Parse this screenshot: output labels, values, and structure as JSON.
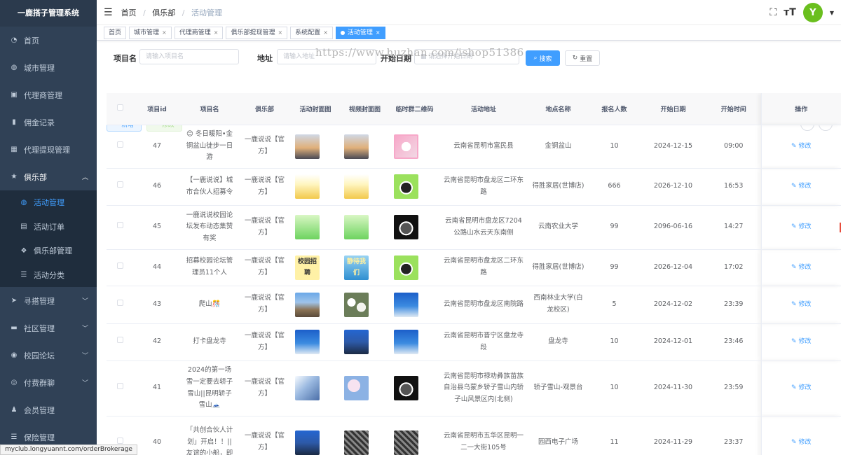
{
  "sidebar": {
    "title": "一鹿搭子管理系统",
    "items": [
      {
        "label": "首页",
        "icon": "dashboard-icon"
      },
      {
        "label": "城市管理",
        "icon": "globe-icon"
      },
      {
        "label": "代理商管理",
        "icon": "id-card-icon"
      },
      {
        "label": "佣金记录",
        "icon": "bar-chart-icon"
      },
      {
        "label": "代理提现管理",
        "icon": "table-icon"
      },
      {
        "label": "俱乐部",
        "icon": "star-icon"
      }
    ],
    "club_sub": [
      {
        "label": "活动管理",
        "icon": "globe-icon"
      },
      {
        "label": "活动订单",
        "icon": "document-icon"
      },
      {
        "label": "俱乐部管理",
        "icon": "user-group-icon"
      },
      {
        "label": "活动分类",
        "icon": "list-icon"
      }
    ],
    "items_after": [
      {
        "label": "寻搭管理",
        "icon": "send-icon"
      },
      {
        "label": "社区管理",
        "icon": "chat-icon"
      },
      {
        "label": "校园论坛",
        "icon": "forum-icon"
      },
      {
        "label": "付费群聊",
        "icon": "wechat-icon"
      },
      {
        "label": "会员管理",
        "icon": "member-icon"
      },
      {
        "label": "保险管理",
        "icon": "list-icon"
      }
    ]
  },
  "breadcrumb": {
    "home": "首页",
    "parent": "俱乐部",
    "current": "活动管理"
  },
  "tabs": [
    {
      "label": "首页"
    },
    {
      "label": "城市管理"
    },
    {
      "label": "代理商管理"
    },
    {
      "label": "俱乐部提现管理"
    },
    {
      "label": "系统配置"
    },
    {
      "label": "活动管理"
    }
  ],
  "avatar_text": "Y",
  "search": {
    "name_label": "项目名",
    "name_placeholder": "请输入项目名",
    "address_label": "地址",
    "address_placeholder": "请输入地址",
    "start_label": "开始日期",
    "start_placeholder": "请选择开始日期",
    "search_btn": "搜索",
    "reset_btn": "重置",
    "add_btn": "新增",
    "edit_btn": "修改"
  },
  "watermark": "https://www.huzhan.com/ishop51386",
  "table": {
    "headers": [
      "项目id",
      "项目名",
      "俱乐部",
      "活动封面图",
      "视频封面图",
      "临时群二维码",
      "活动地址",
      "地点名称",
      "报名人数",
      "开始日期",
      "开始时间",
      "操作"
    ],
    "edit_label": "修改",
    "rows": [
      {
        "id": "47",
        "name": "😊 冬日暖阳•金铜盆山徒步一日游",
        "club": "一鹿说说【官方】",
        "cover": "t-sunset",
        "cover_text": "",
        "video": "t-sunset",
        "video_text": "",
        "qr": "t-qr",
        "address": "云南省昆明市富民县",
        "place": "金铜盆山",
        "count": "10",
        "date": "2024-12-15",
        "time": "09:00"
      },
      {
        "id": "46",
        "name": "【一鹿说说】城市合伙人招募令",
        "club": "一鹿说说【官方】",
        "cover": "t-yellow",
        "cover_text": "",
        "video": "t-yellow",
        "video_text": "",
        "qr": "t-qr-green",
        "address": "云南省昆明市盘龙区二环东路",
        "place": "得胜家居(世博店)",
        "count": "666",
        "date": "2026-12-10",
        "time": "16:53"
      },
      {
        "id": "45",
        "name": "一鹿说说校园论坛发布动态集赞有奖",
        "club": "一鹿说说【官方】",
        "cover": "t-green",
        "cover_text": "",
        "video": "t-green",
        "video_text": "",
        "qr": "t-qr-dark",
        "address": "云南省昆明市盘龙区7204公路山水云天东南侧",
        "place": "云南农业大学",
        "count": "99",
        "date": "2096-06-16",
        "time": "14:27"
      },
      {
        "id": "44",
        "name": "招募校园论坛管理员11个人",
        "club": "一鹿说说【官方】",
        "cover": "t-campus",
        "cover_text": "校园招聘",
        "video": "t-sea",
        "video_text": "静待我们",
        "qr": "t-qr-green",
        "address": "云南省昆明市盘龙区二环东路",
        "place": "得胜家居(世博店)",
        "count": "99",
        "date": "2026-12-04",
        "time": "17:02"
      },
      {
        "id": "43",
        "name": "爬山🎊",
        "club": "一鹿说说【官方】",
        "cover": "t-city",
        "cover_text": "",
        "video": "t-flower",
        "video_text": "",
        "qr": "t-blue",
        "address": "云南省昆明市盘龙区南院路",
        "place": "西南林业大学(白龙校区)",
        "count": "5",
        "date": "2024-12-02",
        "time": "23:39"
      },
      {
        "id": "42",
        "name": "打卡盘龙寺",
        "club": "一鹿说说【官方】",
        "cover": "t-blue",
        "cover_text": "",
        "video": "t-night",
        "video_text": "",
        "qr": "t-blue",
        "address": "云南省昆明市晋宁区盘龙寺段",
        "place": "盘龙寺",
        "count": "10",
        "date": "2024-12-01",
        "time": "23:46"
      },
      {
        "id": "41",
        "name": "2024的第一场雪一定要去轿子雪山||昆明轿子雪山🗻",
        "club": "一鹿说说【官方】",
        "cover": "t-snow",
        "cover_text": "",
        "video": "t-blossom",
        "video_text": "",
        "qr": "t-qr-dark",
        "address": "云南省昆明市禄劝彝族苗族自治县乌蒙乡轿子雪山内轿子山风景区内(北侧)",
        "place": "轿子雪山-观景台",
        "count": "10",
        "date": "2024-11-30",
        "time": "23:59"
      },
      {
        "id": "40",
        "name": "「共创合伙人计划」开启！！||友谊的小船，即",
        "club": "一鹿说说【官方】",
        "cover": "t-night",
        "cover_text": "",
        "video": "t-gray",
        "video_text": "",
        "qr": "t-gray",
        "address": "云南省昆明市五华区昆明一二一大街105号",
        "place": "园西电子广场",
        "count": "11",
        "date": "2024-11-29",
        "time": "23:37"
      }
    ]
  },
  "status_url": "myclub.longyuannt.com/orderBrokerage",
  "colors": {
    "sidebar_bg": "#304156",
    "primary": "#409eff",
    "accent_green": "#6abf1e"
  }
}
